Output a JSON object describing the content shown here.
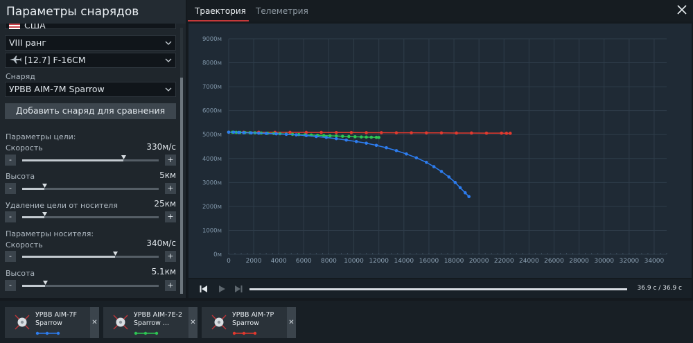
{
  "left_panel": {
    "title": "Параметры снарядов",
    "country_label": "США",
    "rank_label": "VIII ранг",
    "vehicle_label": "[12.7] F-16CM",
    "projectile_section_label": "Снаряд",
    "projectile_value": "УРВВ AIM-7M Sparrow",
    "add_button_label": "Добавить снаряд для сравнения",
    "target_section_label": "Параметры цели:",
    "carrier_section_label": "Параметры носителя:",
    "sliders": [
      {
        "label": "Скорость",
        "value_text": "330м/с",
        "fraction": 0.74
      },
      {
        "label": "Высота",
        "value_text": "5км",
        "fraction": 0.16
      },
      {
        "label": "Удаление цели от носителя",
        "value_text": "25км",
        "fraction": 0.16
      },
      {
        "label": "Скорость",
        "value_text": "340м/с",
        "fraction": 0.68
      },
      {
        "label": "Высота",
        "value_text": "5.1км",
        "fraction": 0.17
      }
    ],
    "minus_label": "-",
    "plus_label": "+"
  },
  "tabs": [
    {
      "label": "Траектория",
      "active": true
    },
    {
      "label": "Телеметрия",
      "active": false
    }
  ],
  "playback": {
    "time_text": "36.9 с  /  36.9 с"
  },
  "cards": [
    {
      "name": "УРВВ AIM-7F Sparrow",
      "color": "#2d7df0"
    },
    {
      "name": "УРВВ AIM-7E-2 Sparrow ...",
      "color": "#2dc653"
    },
    {
      "name": "УРВВ AIM-7P Sparrow",
      "color": "#e2392e"
    }
  ],
  "colors": {
    "accent": "#c5393a",
    "blue_series": "#2d7df0",
    "green_series": "#2dc653",
    "red_series": "#e2392e"
  },
  "chart_data": {
    "type": "line",
    "title": "",
    "xlabel": "",
    "ylabel": "",
    "xlim": [
      0,
      35000
    ],
    "ylim": [
      0,
      9000
    ],
    "x_ticks": [
      "0",
      "2000",
      "4000",
      "6000",
      "8000",
      "10000",
      "12000",
      "14000",
      "16000",
      "18000",
      "20000",
      "22000",
      "24000",
      "26000",
      "28000",
      "30000",
      "32000",
      "34000"
    ],
    "y_ticks": [
      "0м",
      "1000м",
      "2000м",
      "3000м",
      "4000м",
      "5000м",
      "6000м",
      "7000м",
      "8000м",
      "9000м"
    ],
    "grid": true,
    "legend": "none",
    "series": [
      {
        "color": "#2d7df0",
        "x": [
          0,
          400,
          800,
          1200,
          1800,
          2400,
          3000,
          3800,
          4600,
          5400,
          6200,
          7000,
          7800,
          8600,
          9400,
          10200,
          11000,
          11800,
          12600,
          13400,
          14200,
          15000,
          15800,
          16400,
          17000,
          17600,
          18100,
          18500,
          18900,
          19200
        ],
        "y": [
          5100,
          5100,
          5090,
          5080,
          5070,
          5060,
          5050,
          5030,
          5010,
          4990,
          4960,
          4920,
          4880,
          4830,
          4770,
          4710,
          4640,
          4550,
          4450,
          4330,
          4190,
          4030,
          3840,
          3660,
          3460,
          3230,
          3000,
          2780,
          2570,
          2410
        ]
      },
      {
        "color": "#2dc653",
        "x": [
          0,
          300,
          600,
          900,
          1300,
          1700,
          2100,
          2600,
          3100,
          3600,
          4100,
          4600,
          5100,
          5600,
          6100,
          6600,
          7100,
          7600,
          8100,
          8600,
          9100,
          9600,
          10100,
          10600,
          11000,
          11400,
          11800,
          12000
        ],
        "y": [
          5100,
          5100,
          5095,
          5090,
          5085,
          5080,
          5075,
          5065,
          5055,
          5045,
          5035,
          5020,
          5010,
          5000,
          4990,
          4980,
          4970,
          4960,
          4950,
          4940,
          4930,
          4920,
          4910,
          4900,
          4895,
          4890,
          4885,
          4880
        ]
      },
      {
        "color": "#e2392e",
        "x": [
          0,
          1200,
          2400,
          3700,
          4900,
          6200,
          7400,
          8600,
          9800,
          11000,
          12200,
          13400,
          14600,
          15800,
          17000,
          18200,
          19400,
          20600,
          21800,
          22200,
          22500
        ],
        "y": [
          5100,
          5100,
          5100,
          5095,
          5095,
          5090,
          5090,
          5085,
          5085,
          5080,
          5080,
          5075,
          5075,
          5070,
          5070,
          5065,
          5065,
          5060,
          5060,
          5055,
          5055
        ]
      }
    ]
  }
}
